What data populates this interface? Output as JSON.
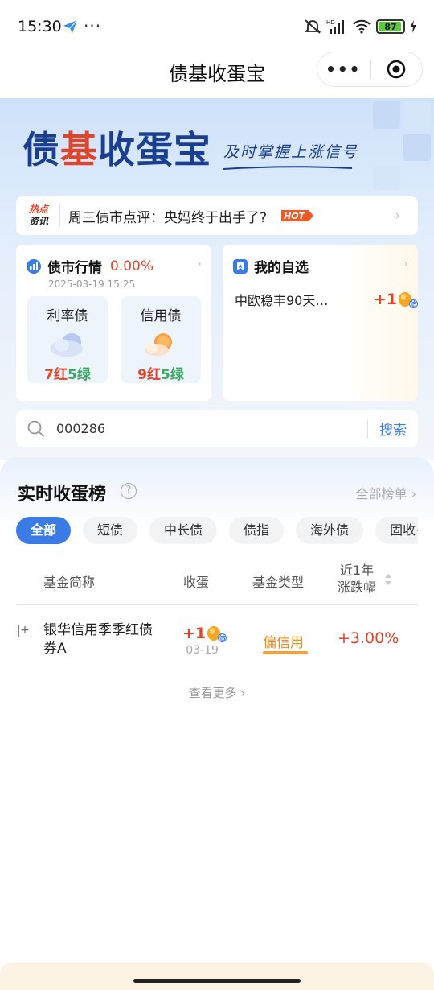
{
  "status_bar": {
    "time": "15:30",
    "dots": "···",
    "battery": "87"
  },
  "title_bar": {
    "title": "债基收蛋宝",
    "more_icon": "more-dots-icon",
    "target_icon": "target-icon"
  },
  "hero": {
    "title": "债基收蛋宝",
    "subtitle": "及时掌握上涨信号"
  },
  "news": {
    "tag_line1": "热点",
    "tag_line2": "资讯",
    "text": "周三债市点评：央妈终于出手了?",
    "hot_label": "HOT"
  },
  "market_card": {
    "title": "债市行情",
    "pct": "0.00%",
    "date": "2025-03-19 15:25",
    "tiles": [
      {
        "name": "利率债",
        "red": "7红",
        "green": "5绿",
        "icon": "cloudy-icon"
      },
      {
        "name": "信用债",
        "red": "9红",
        "green": "5绿",
        "icon": "sun-cloud-icon"
      }
    ]
  },
  "watchlist_card": {
    "title": "我的自选",
    "fund_name": "中欧稳丰90天…",
    "value": "+1",
    "est_tag": "估"
  },
  "search": {
    "value": "000286",
    "button": "搜索"
  },
  "ranking": {
    "title": "实时收蛋榜",
    "help": "?",
    "all_link": "全部榜单 ›",
    "tabs": [
      "全部",
      "短债",
      "中长债",
      "债指",
      "海外债",
      "固收+"
    ],
    "active_tab": "全部",
    "columns": {
      "name": "基金简称",
      "eggs": "收蛋",
      "type": "基金类型",
      "change_line1": "近1年",
      "change_line2": "涨跌幅"
    },
    "rows": [
      {
        "name": "银华信用季季红债券A",
        "eggs": "+1",
        "est_tag": "估",
        "date": "03-19",
        "type": "偏信用",
        "change": "+3.00%"
      }
    ],
    "more": "查看更多 ›"
  },
  "colors": {
    "accent_blue": "#3b7be6",
    "red": "#e0452b",
    "green": "#3aa760",
    "orange": "#f08a1c"
  }
}
